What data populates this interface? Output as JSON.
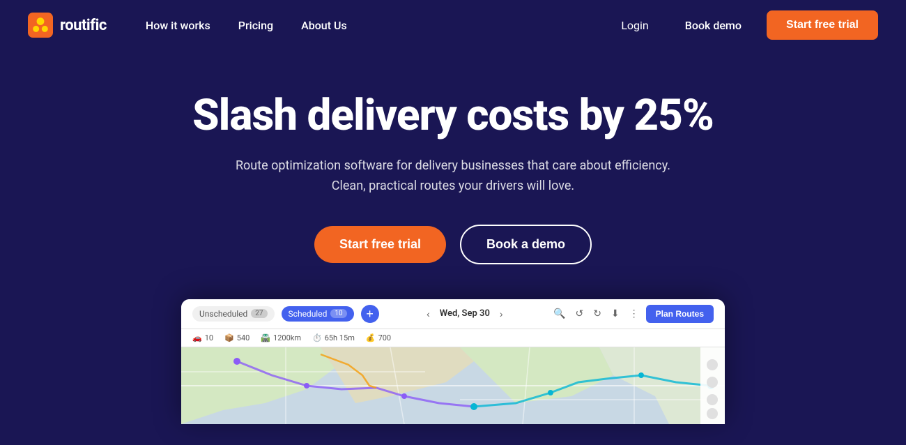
{
  "brand": {
    "name": "routific",
    "logo_alt": "routific logo"
  },
  "nav": {
    "links": [
      {
        "label": "How it works",
        "id": "how-it-works"
      },
      {
        "label": "Pricing",
        "id": "pricing"
      },
      {
        "label": "About Us",
        "id": "about-us"
      }
    ],
    "login_label": "Login",
    "book_demo_label": "Book demo",
    "start_trial_label": "Start free trial"
  },
  "hero": {
    "title": "Slash delivery costs by 25%",
    "subtitle_line1": "Route optimization software for delivery businesses that care about efficiency.",
    "subtitle_line2": "Clean, practical routes your drivers will love.",
    "btn_trial": "Start free trial",
    "btn_demo": "Book a demo"
  },
  "app_preview": {
    "tab_unscheduled": "Unscheduled",
    "tab_unscheduled_badge": "27",
    "tab_scheduled": "Scheduled",
    "tab_scheduled_badge": "10",
    "date": "Wed, Sep 30",
    "stats": [
      {
        "icon": "🚗",
        "value": "10"
      },
      {
        "icon": "📦",
        "value": "540"
      },
      {
        "icon": "🛣️",
        "value": "1200km"
      },
      {
        "icon": "⏱️",
        "value": "65h 15m"
      },
      {
        "icon": "💰",
        "value": "700"
      }
    ],
    "plan_routes_btn": "Plan Routes"
  },
  "colors": {
    "bg": "#1a1654",
    "orange": "#f26522",
    "blue": "#4361ee",
    "white": "#ffffff"
  }
}
